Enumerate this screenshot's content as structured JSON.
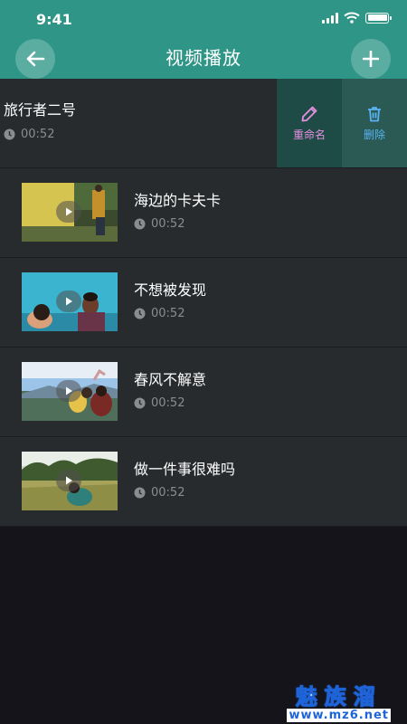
{
  "status_bar": {
    "time": "9:41"
  },
  "header": {
    "title": "视频播放"
  },
  "videos": [
    {
      "title": "旅行者二号",
      "duration": "00:52"
    },
    {
      "title": "海边的卡夫卡",
      "duration": "00:52"
    },
    {
      "title": "不想被发现",
      "duration": "00:52"
    },
    {
      "title": "春风不解意",
      "duration": "00:52"
    },
    {
      "title": "做一件事很难吗",
      "duration": "00:52"
    }
  ],
  "actions": {
    "rename": "重命名",
    "delete": "删除"
  },
  "watermark": {
    "line1": "魅族溜",
    "line2": "www.mz6.net"
  },
  "colors": {
    "header": "#2f9687",
    "row": "#272b2e",
    "background": "#15141a",
    "rename": "#e58fe0",
    "delete": "#59b3f4"
  }
}
